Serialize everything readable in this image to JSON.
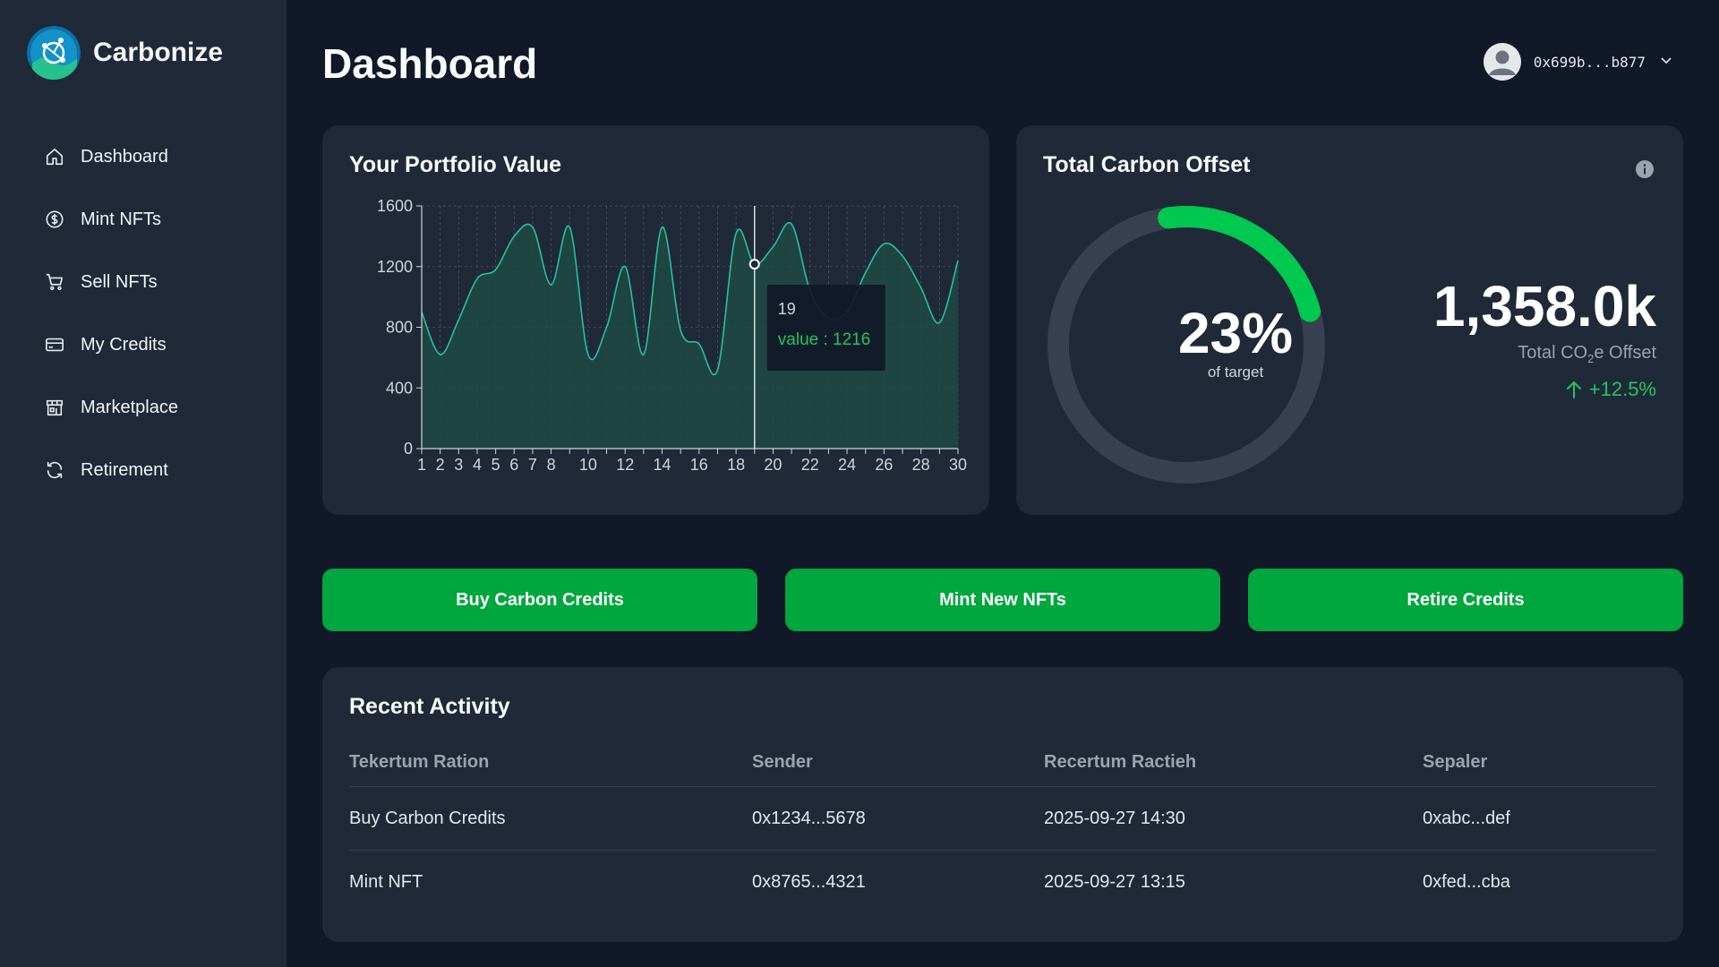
{
  "app": {
    "name": "Carbonize"
  },
  "sidebar": {
    "items": [
      {
        "label": "Dashboard",
        "icon": "home-icon"
      },
      {
        "label": "Mint NFTs",
        "icon": "dollar-coin-icon"
      },
      {
        "label": "Sell NFTs",
        "icon": "cart-icon"
      },
      {
        "label": "My Credits",
        "icon": "credit-card-icon"
      },
      {
        "label": "Marketplace",
        "icon": "store-icon"
      },
      {
        "label": "Retirement",
        "icon": "refresh-icon"
      }
    ]
  },
  "header": {
    "title": "Dashboard",
    "wallet": "0x699b...b877",
    "avatar_icon": "user-avatar-icon",
    "dropdown_icon": "chevron-down-icon"
  },
  "portfolio": {
    "title": "Your Portfolio Value",
    "tooltip": {
      "label": "19",
      "value_text": "value : 1216"
    }
  },
  "chart_data": {
    "type": "area",
    "title": "Your Portfolio Value",
    "x": [
      1,
      2,
      3,
      4,
      5,
      6,
      7,
      8,
      9,
      10,
      11,
      12,
      13,
      14,
      15,
      16,
      17,
      18,
      19,
      20,
      21,
      22,
      23,
      24,
      25,
      26,
      27,
      28,
      29,
      30
    ],
    "x_tick_labels": [
      "1",
      "2",
      "3",
      "4",
      "5",
      "6",
      "7",
      "8",
      "10",
      "12",
      "14",
      "16",
      "18",
      "20",
      "22",
      "24",
      "26",
      "28",
      "30"
    ],
    "series": [
      {
        "values": [
          900,
          620,
          850,
          1120,
          1180,
          1400,
          1460,
          1080,
          1460,
          620,
          800,
          1200,
          620,
          1460,
          780,
          690,
          520,
          1420,
          1216,
          1330,
          1480,
          1040,
          860,
          900,
          1160,
          1350,
          1270,
          1060,
          830,
          1240
        ]
      }
    ],
    "ylim": [
      0,
      1600
    ],
    "y_ticks": [
      0,
      400,
      800,
      1200,
      1600
    ],
    "grid": true,
    "highlight": {
      "x": 19,
      "y": 1216
    },
    "colors": {
      "line": "#22c3a0",
      "fill": "#1e4a44",
      "grid": "#4b5563"
    }
  },
  "carbon": {
    "title": "Total Carbon Offset",
    "percent_text": "23%",
    "percent_value": 23,
    "percent_sub": "of target",
    "total": "1,358.0k",
    "total_label_pre": "Total CO",
    "total_label_sub": "2",
    "total_label_post": "e Offset",
    "change": "+12.5%",
    "colors": {
      "progress": "#00c950",
      "track": "#374151"
    }
  },
  "actions": {
    "buy": "Buy Carbon Credits",
    "mint": "Mint New NFTs",
    "retire": "Retire Credits"
  },
  "activity": {
    "title": "Recent Activity",
    "columns": [
      "Tekertum Ration",
      "Sender",
      "Recertum Ractieh",
      "Sepaler"
    ],
    "rows": [
      [
        "Buy Carbon Credits",
        "0x1234...5678",
        "2025-09-27 14:30",
        "0xabc...def"
      ],
      [
        "Mint NFT",
        "0x8765...4321",
        "2025-09-27 13:15",
        "0xfed...cba"
      ]
    ]
  },
  "colors": {
    "bg": "#111827",
    "panel": "#1f2937",
    "accent": "#00a63e"
  }
}
